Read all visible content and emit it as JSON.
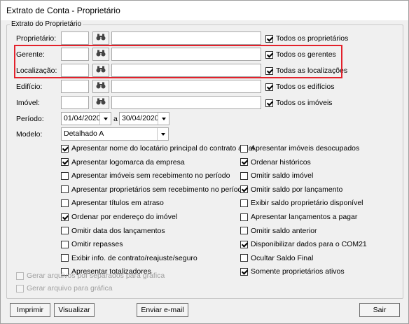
{
  "window": {
    "title": "Extrato de Conta - Proprietário"
  },
  "group": {
    "legend": "Extrato do Proprietário"
  },
  "filters": {
    "proprietario": {
      "label": "Proprietário:",
      "all_label": "Todos os proprietários",
      "all_checked": true
    },
    "gerente": {
      "label": "Gerente:",
      "all_label": "Todos os gerentes",
      "all_checked": true
    },
    "localizacao": {
      "label": "Localização:",
      "all_label": "Todas as localizações",
      "all_checked": true
    },
    "edificio": {
      "label": "Edifício:",
      "all_label": "Todos os edifícios",
      "all_checked": true
    },
    "imovel": {
      "label": "Imóvel:",
      "all_label": "Todos os imóveis",
      "all_checked": true
    }
  },
  "periodo": {
    "label": "Período:",
    "start": "01/04/2020",
    "separator": "a",
    "end": "30/04/2020"
  },
  "modelo": {
    "label": "Modelo:",
    "value": "Detalhado A"
  },
  "options_left": [
    {
      "label": "Apresentar nome do locatário principal do contrato atual",
      "checked": true
    },
    {
      "label": "Apresentar logomarca da empresa",
      "checked": true
    },
    {
      "label": "Apresentar imóveis sem recebimento no período",
      "checked": false
    },
    {
      "label": "Apresentar proprietários sem recebimento no período",
      "checked": false
    },
    {
      "label": "Apresentar títulos em atraso",
      "checked": false
    },
    {
      "label": "Ordenar por endereço do imóvel",
      "checked": true
    },
    {
      "label": "Omitir data dos lançamentos",
      "checked": false
    },
    {
      "label": "Omitir repasses",
      "checked": false
    },
    {
      "label": "Exibir info. de contrato/reajuste/seguro",
      "checked": false
    },
    {
      "label": "Apresentar totalizadores",
      "checked": false
    }
  ],
  "options_right": [
    {
      "label": "Apresentar imóveis desocupados",
      "checked": false
    },
    {
      "label": "Ordenar históricos",
      "checked": true
    },
    {
      "label": "Omitir saldo imóvel",
      "checked": false
    },
    {
      "label": "Omitir saldo por lançamento",
      "checked": true
    },
    {
      "label": "Exibir saldo proprietário disponível",
      "checked": false
    },
    {
      "label": "Apresentar lançamentos a pagar",
      "checked": false
    },
    {
      "label": "Omitir saldo anterior",
      "checked": false
    },
    {
      "label": "Disponibilizar dados para o COM21",
      "checked": true
    },
    {
      "label": "Ocultar Saldo Final",
      "checked": false
    },
    {
      "label": "Somente proprietários ativos",
      "checked": true
    }
  ],
  "disabled_options": [
    {
      "label": "Gerar arquivos pdf separados para gráfica"
    },
    {
      "label": "Gerar arquivo para gráfica"
    }
  ],
  "buttons": {
    "print": "Imprimir",
    "view": "Visualizar",
    "email": "Enviar e-mail",
    "exit": "Sair"
  }
}
